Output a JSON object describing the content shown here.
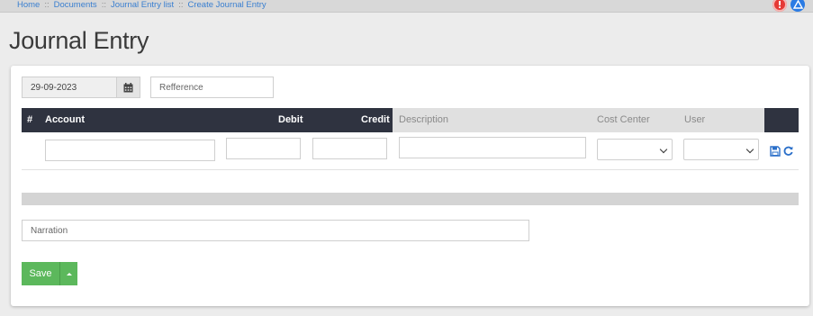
{
  "breadcrumb": {
    "items": [
      "Home",
      "Documents",
      "Journal Entry  list",
      "Create Journal Entry"
    ],
    "separator": "::"
  },
  "alerts": {
    "red_icon": "alert-circle-icon",
    "blue_icon": "warning-triangle-icon",
    "red_color": "#e53935",
    "blue_color": "#2a7be4"
  },
  "page": {
    "title": "Journal Entry"
  },
  "form": {
    "date_value": "29-09-2023",
    "reference_placeholder": "Refference",
    "narration_placeholder": "Narration"
  },
  "table": {
    "headers": {
      "hash": "#",
      "account": "Account",
      "debit": "Debit",
      "credit": "Credit",
      "description": "Description",
      "cost_center": "Cost Center",
      "user": "User"
    },
    "header_dark_color": "#2f3340"
  },
  "actions": {
    "save_label": "Save",
    "save_color": "#5cb85c"
  }
}
